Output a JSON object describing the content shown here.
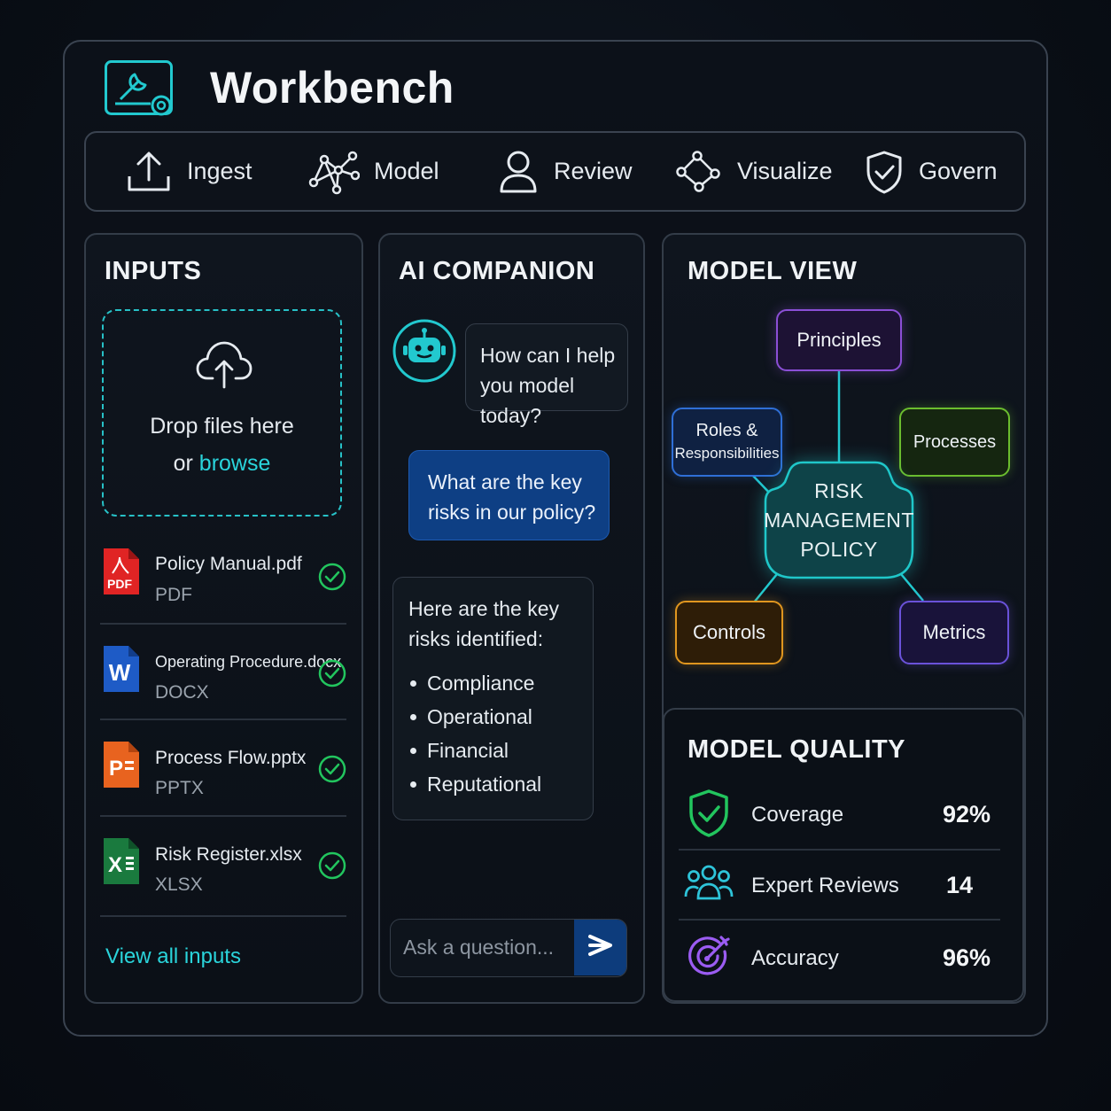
{
  "app": {
    "title": "Workbench",
    "logo_icon": "wrench-gear-icon"
  },
  "toolbar": {
    "items": [
      {
        "label": "Ingest",
        "icon": "upload-icon"
      },
      {
        "label": "Model",
        "icon": "network-graph-icon"
      },
      {
        "label": "Review",
        "icon": "user-icon"
      },
      {
        "label": "Visualize",
        "icon": "graph-nodes-icon"
      },
      {
        "label": "Govern",
        "icon": "shield-check-icon"
      }
    ]
  },
  "inputs": {
    "title": "INPUTS",
    "dropzone": {
      "line1": "Drop files here",
      "line2_prefix": "or",
      "browse_label": "browse",
      "icon": "cloud-upload-icon"
    },
    "files": [
      {
        "name": "Policy Manual.pdf",
        "type": "PDF",
        "icon": "pdf-icon",
        "icon_text": "PDF",
        "status": "uploaded"
      },
      {
        "name": "Operating Procedure.docx",
        "type": "DOCX",
        "icon": "word-icon",
        "icon_text": "W",
        "status": "uploaded"
      },
      {
        "name": "Process Flow.pptx",
        "type": "PPTX",
        "icon": "powerpoint-icon",
        "icon_text": "P",
        "status": "uploaded"
      },
      {
        "name": "Risk Register.xlsx",
        "type": "XLSX",
        "icon": "excel-icon",
        "icon_text": "X",
        "status": "uploaded"
      }
    ],
    "view_all_label": "View all inputs"
  },
  "companion": {
    "title": "AI COMPANION",
    "bot_icon": "robot-icon",
    "bot_greeting": [
      "How can I help",
      "you model today?"
    ],
    "user_question": [
      "What are the key",
      "risks in our policy?"
    ],
    "answer_intro": [
      "Here are the key",
      "risks identified:"
    ],
    "answer_items": [
      "Compliance",
      "Operational",
      "Financial",
      "Reputational"
    ],
    "ask_placeholder": "Ask a question...",
    "send_icon": "send-arrow-icon"
  },
  "model_view": {
    "title": "MODEL VIEW",
    "center": [
      "RISK",
      "MANAGEMENT",
      "POLICY"
    ],
    "nodes": {
      "principles": "Principles",
      "roles": [
        "Roles &",
        "Responsibilities"
      ],
      "processes": "Processes",
      "controls": "Controls",
      "metrics": "Metrics"
    },
    "colors": {
      "center": "#1fc7c9",
      "principles": "#8b4fd6",
      "roles": "#2f6fd6",
      "processes": "#6bbd2e",
      "controls": "#e0961f",
      "metrics": "#6a52d9"
    }
  },
  "quality": {
    "title": "MODEL QUALITY",
    "metrics": [
      {
        "label": "Coverage",
        "value": "92%",
        "icon": "shield-check-icon",
        "color": "#22c55e"
      },
      {
        "label": "Expert Reviews",
        "value": "14",
        "icon": "users-group-icon",
        "color": "#2ec4d9"
      },
      {
        "label": "Accuracy",
        "value": "96%",
        "icon": "target-icon",
        "color": "#9b5cf2"
      }
    ]
  }
}
